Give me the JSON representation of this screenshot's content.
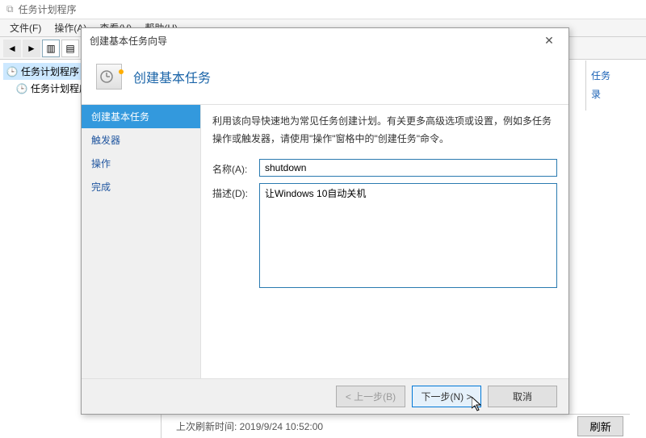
{
  "app": {
    "title": "任务计划程序"
  },
  "menu": {
    "file": "文件(F)",
    "action": "操作(A)",
    "view": "查看(V)",
    "help": "帮助(H)"
  },
  "tree": {
    "root": "任务计划程序 (本地",
    "library": "任务计划程序库"
  },
  "rightPanel": {
    "item1": "任务",
    "item2": "录"
  },
  "status": {
    "last_refresh_label": "上次刷新时间: 2019/9/24 10:52:00",
    "refresh_button": "刷新"
  },
  "wizard": {
    "windowTitle": "创建基本任务向导",
    "headerTitle": "创建基本任务",
    "nav": {
      "step1": "创建基本任务",
      "step2": "触发器",
      "step3": "操作",
      "step4": "完成"
    },
    "description": "利用该向导快速地为常见任务创建计划。有关更多高级选项或设置，例如多任务操作或触发器，请使用\"操作\"窗格中的\"创建任务\"命令。",
    "form": {
      "name_label": "名称(A):",
      "name_value": "shutdown",
      "desc_label": "描述(D):",
      "desc_value": "让Windows 10自动关机"
    },
    "buttons": {
      "back": "< 上一步(B)",
      "next": "下一步(N) >",
      "cancel": "取消"
    }
  }
}
